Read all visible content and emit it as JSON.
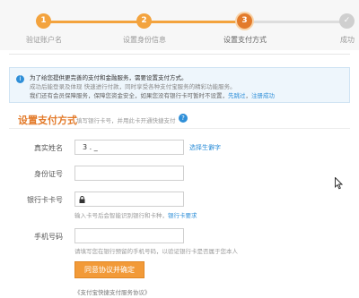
{
  "steps": [
    {
      "number": "1",
      "label": "验证账户名",
      "state": "done"
    },
    {
      "number": "2",
      "label": "设置身份信息",
      "state": "done"
    },
    {
      "number": "3",
      "label": "设置支付方式",
      "state": "current"
    },
    {
      "number": "✓",
      "label": "成功",
      "state": "todo"
    }
  ],
  "notice": {
    "line1": "为了给您提供更完善的支付和金融服务，需要设置支付方式。",
    "line2": "成功后能登录及体现 快速进行付款，同时享受各种支付宝服务的精彩功能服务。",
    "line3": "我们还有会员保障服务，保障您资金安全，如果您没有银行卡可暂时不设置，",
    "link1": "先跳过",
    "link2": "注册成功"
  },
  "section": {
    "title": "设置支付方式",
    "note": "填写银行卡号，并用此卡开通快捷支付"
  },
  "form": {
    "name_label": "真实姓名",
    "name_value": "3 .  _",
    "name_link": "选择生僻字",
    "id_label": "身份证号",
    "card_label": "银行卡卡号",
    "card_hint": "输入卡号后会智能识别银行和卡种，",
    "card_hint_link": "银行卡要求",
    "phone_label": "手机号码",
    "phone_hint1": "请填写您在银行预留的手机号码，以验证银行卡是否属于您本人",
    "submit_label": "同意协议并确定",
    "agreement": "《支付宝快捷支付服务协议》"
  },
  "colors": {
    "accent": "#e37b2b",
    "done": "#f3a33e",
    "link": "#2f8fd8"
  }
}
